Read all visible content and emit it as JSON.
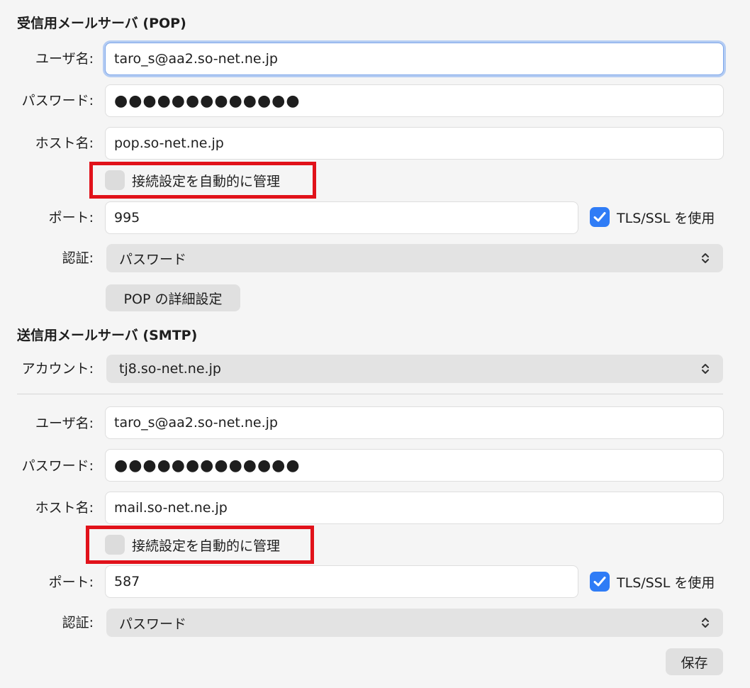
{
  "incoming": {
    "title": "受信用メールサーバ (POP)",
    "username_label": "ユーザ名:",
    "username_value": "taro_s@aa2.so-net.ne.jp",
    "password_label": "パスワード:",
    "password_value": "●●●●●●●●●●●●●",
    "host_label": "ホスト名:",
    "host_value": "pop.so-net.ne.jp",
    "auto_manage_label": "接続設定を自動的に管理",
    "auto_manage_checked": false,
    "port_label": "ポート:",
    "port_value": "995",
    "tls_label": "TLS/SSL を使用",
    "tls_checked": true,
    "auth_label": "認証:",
    "auth_value": "パスワード",
    "advanced_button": "POP の詳細設定"
  },
  "outgoing": {
    "title": "送信用メールサーバ (SMTP)",
    "account_label": "アカウント:",
    "account_value": "tj8.so-net.ne.jp",
    "username_label": "ユーザ名:",
    "username_value": "taro_s@aa2.so-net.ne.jp",
    "password_label": "パスワード:",
    "password_value": "●●●●●●●●●●●●●",
    "host_label": "ホスト名:",
    "host_value": "mail.so-net.ne.jp",
    "auto_manage_label": "接続設定を自動的に管理",
    "auto_manage_checked": false,
    "port_label": "ポート:",
    "port_value": "587",
    "tls_label": "TLS/SSL を使用",
    "tls_checked": true,
    "auth_label": "認証:",
    "auth_value": "パスワード"
  },
  "save_button": "保存",
  "colors": {
    "background": "#f5f5f5",
    "accent": "#2f7cf6",
    "focus_ring": "#b4ccf3",
    "highlight": "#e1121a"
  },
  "icons": {
    "checkmark": "checkmark-icon",
    "select_arrows": "chevron-up-down-icon"
  }
}
